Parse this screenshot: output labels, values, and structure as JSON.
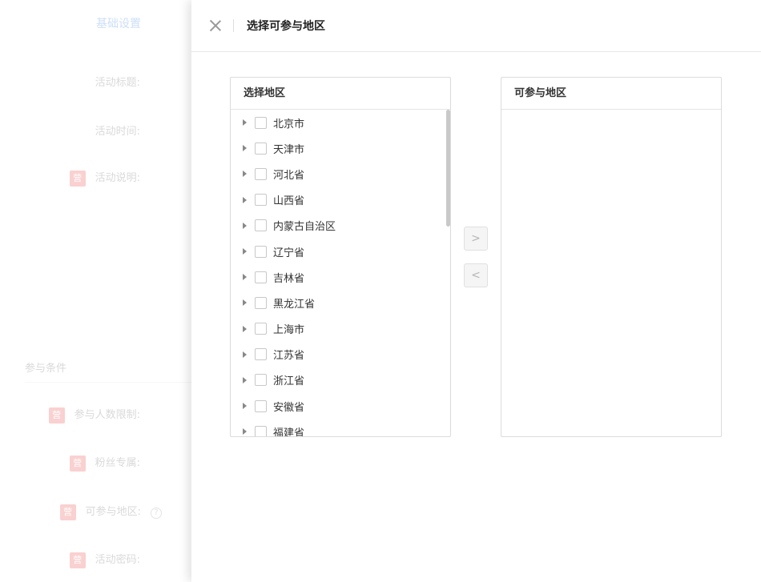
{
  "background_form": {
    "section_link": "基础设置",
    "fields": [
      {
        "label": "活动标题:",
        "tag": ""
      },
      {
        "label": "活动时间:",
        "tag": ""
      },
      {
        "label": "活动说明:",
        "tag": "营"
      }
    ],
    "group_title": "参与条件",
    "conditions": [
      {
        "label": "参与人数限制:",
        "tag": "营"
      },
      {
        "label": "粉丝专属:",
        "tag": "营"
      },
      {
        "label": "可参与地区:",
        "tag": "营",
        "help": "?"
      },
      {
        "label": "活动密码:",
        "tag": "营"
      }
    ]
  },
  "drawer": {
    "title": "选择可参与地区"
  },
  "transfer": {
    "left_title": "选择地区",
    "right_title": "可参与地区",
    "to_right_label": ">",
    "to_left_label": "<",
    "regions": [
      "北京市",
      "天津市",
      "河北省",
      "山西省",
      "内蒙古自治区",
      "辽宁省",
      "吉林省",
      "黑龙江省",
      "上海市",
      "江苏省",
      "浙江省",
      "安徽省",
      "福建省"
    ]
  }
}
